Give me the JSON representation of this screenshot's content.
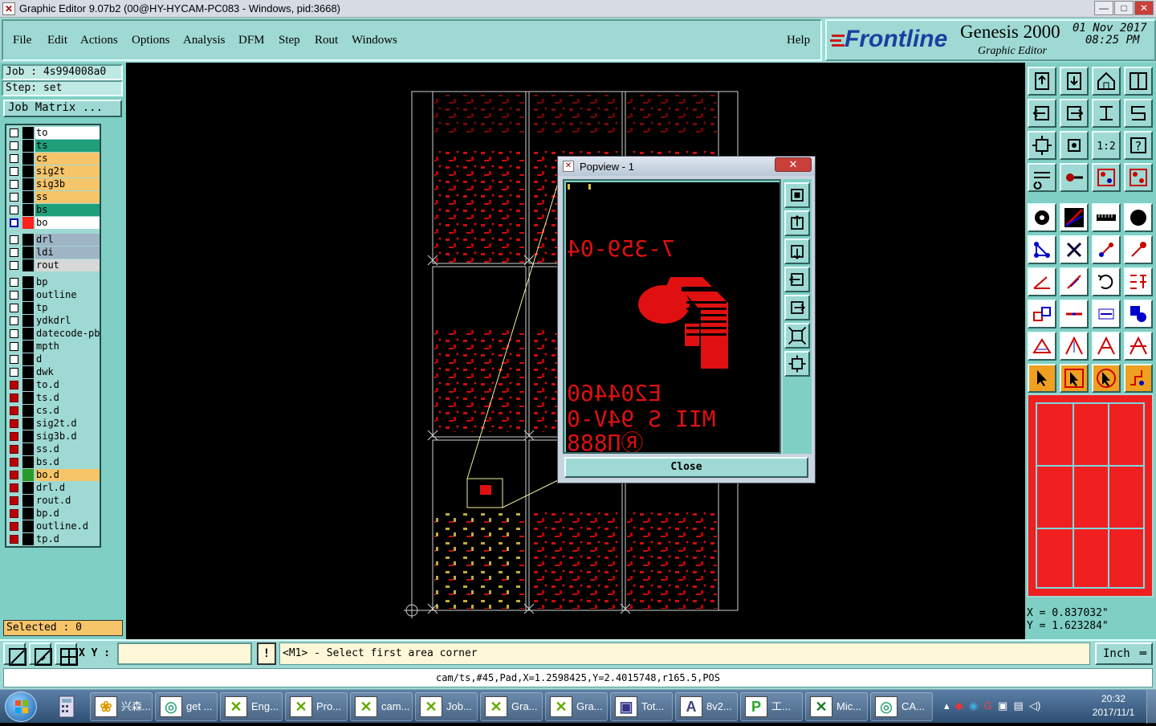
{
  "window": {
    "title": "Graphic Editor 9.07b2 (00@HY-HYCAM-PC083 - Windows, pid:3668)",
    "min": "—",
    "max": "□",
    "close": "✕"
  },
  "menu": {
    "items": [
      "File",
      "Edit",
      "Actions",
      "Options",
      "Analysis",
      "DFM",
      "Step",
      "Rout",
      "Windows"
    ],
    "help": "Help"
  },
  "brand": {
    "logo": "Frontline",
    "product": "Genesis 2000",
    "subtitle": "Graphic Editor",
    "date": "01 Nov 2017",
    "time": "08:25 PM"
  },
  "job": {
    "job": "Job : 4s994008a0",
    "step": "Step: set",
    "matrix_button": "Job Matrix ..."
  },
  "layers": [
    {
      "name": "to",
      "cb": "white",
      "color": "#ffffff"
    },
    {
      "name": "ts",
      "cb": "white",
      "color": "#1f9e7a"
    },
    {
      "name": "cs",
      "cb": "white",
      "color": "#f6c56a"
    },
    {
      "name": "sig2t",
      "cb": "white",
      "color": "#f6c56a"
    },
    {
      "name": "sig3b",
      "cb": "white",
      "color": "#f6c56a"
    },
    {
      "name": "ss",
      "cb": "white",
      "color": "#f6c56a"
    },
    {
      "name": "bs",
      "cb": "white",
      "color": "#1f9e7a"
    },
    {
      "name": "bo",
      "cb": "blue",
      "color": "#ffffff",
      "sw": "#ff2020"
    },
    {
      "name": "drl",
      "cb": "white",
      "color": "#9fb4c4",
      "gap": true
    },
    {
      "name": "ldi",
      "cb": "white",
      "color": "#9fb4c4"
    },
    {
      "name": "rout",
      "cb": "white",
      "color": "#d8d8d8"
    },
    {
      "name": "bp",
      "cb": "white",
      "color": "#9fd9d3",
      "gap": true
    },
    {
      "name": "outline",
      "cb": "white",
      "color": "#9fd9d3"
    },
    {
      "name": "tp",
      "cb": "white",
      "color": "#9fd9d3"
    },
    {
      "name": "ydkdrl",
      "cb": "white",
      "color": "#9fd9d3"
    },
    {
      "name": "datecode-pbe",
      "cb": "white",
      "color": "#9fd9d3"
    },
    {
      "name": "mpth",
      "cb": "white",
      "color": "#9fd9d3"
    },
    {
      "name": "d",
      "cb": "white",
      "color": "#9fd9d3"
    },
    {
      "name": "dwk",
      "cb": "white",
      "color": "#9fd9d3"
    },
    {
      "name": "to.d",
      "cb": "red",
      "color": "#9fd9d3"
    },
    {
      "name": "ts.d",
      "cb": "red",
      "color": "#9fd9d3"
    },
    {
      "name": "cs.d",
      "cb": "red",
      "color": "#9fd9d3"
    },
    {
      "name": "sig2t.d",
      "cb": "red",
      "color": "#9fd9d3"
    },
    {
      "name": "sig3b.d",
      "cb": "red",
      "color": "#9fd9d3"
    },
    {
      "name": "ss.d",
      "cb": "red",
      "color": "#9fd9d3"
    },
    {
      "name": "bs.d",
      "cb": "red",
      "color": "#9fd9d3"
    },
    {
      "name": "bo.d",
      "cb": "red",
      "color": "#f6c56a",
      "sw": "#2a9a2a"
    },
    {
      "name": "drl.d",
      "cb": "red",
      "color": "#9fd9d3"
    },
    {
      "name": "rout.d",
      "cb": "red",
      "color": "#9fd9d3"
    },
    {
      "name": "bp.d",
      "cb": "red",
      "color": "#9fd9d3"
    },
    {
      "name": "outline.d",
      "cb": "red",
      "color": "#9fd9d3"
    },
    {
      "name": "tp.d",
      "cb": "red",
      "color": "#9fd9d3"
    }
  ],
  "selected": "Selected : 0",
  "popview": {
    "title": "Popview - 1",
    "close": "Close",
    "text1": "7-359-04",
    "text2": "E204460",
    "text3": "MII S 94V-0",
    "text4": "ⓇП̨888"
  },
  "coords": {
    "x": "X = 0.837032\"",
    "y": "Y = 1.623284\""
  },
  "bottom": {
    "xy_label": "X Y :",
    "xy_value": "",
    "excl": "!",
    "prompt": "<M1> - Select first area corner",
    "units": "Inch"
  },
  "status": "cam/ts,#45,Pad,X=1.2598425,Y=2.4015748,r165.5,POS",
  "taskbar": {
    "items": [
      "兴森...",
      "get ...",
      "Eng...",
      "Pro...",
      "cam...",
      "Job...",
      "Gra...",
      "Gra...",
      "Tot...",
      "8v2...",
      "工...",
      "Mic...",
      "CA..."
    ],
    "time": "20:32",
    "date": "2017/11/1"
  },
  "colors": {
    "panel": "#9fd9d3",
    "accent": "#7fcfc4",
    "highlight": "#f6c56a",
    "pcb_red": "#e01010"
  }
}
